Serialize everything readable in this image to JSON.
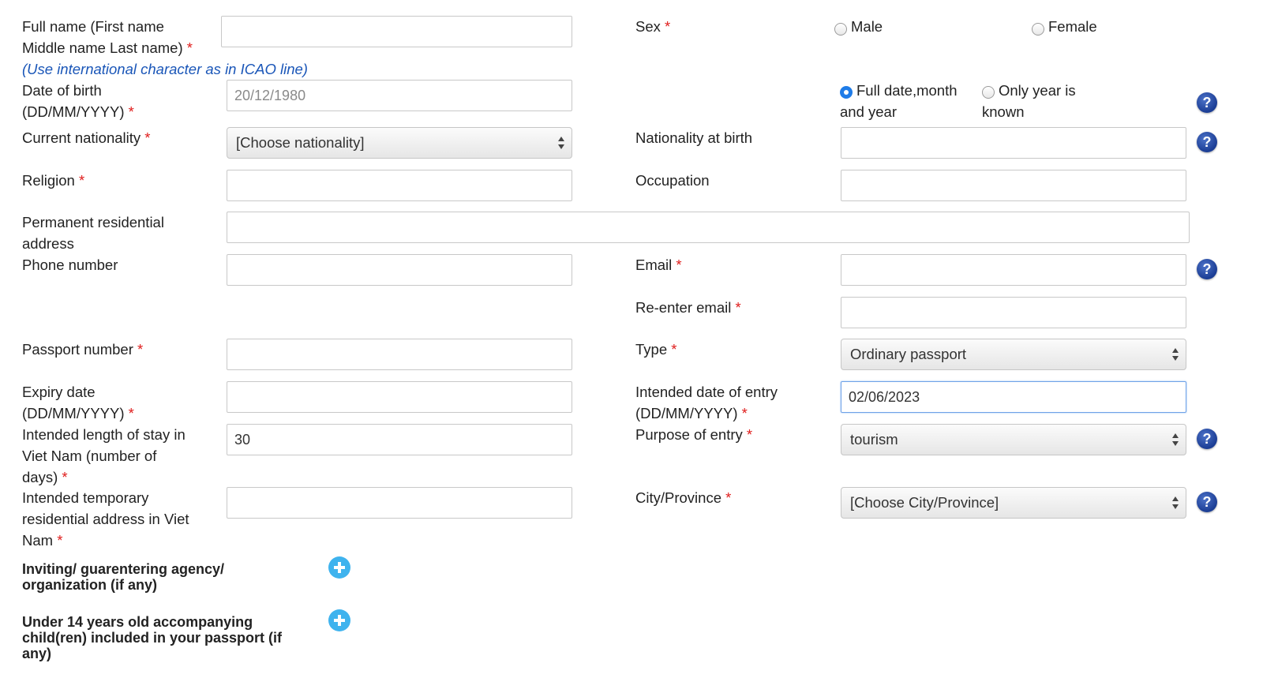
{
  "fields": {
    "full_name": {
      "label_line1": "Full name (First name",
      "label_line2": "Middle name Last name)",
      "required": "*",
      "value": "",
      "hint": "(Use international character as in ICAO line)"
    },
    "sex": {
      "label": "Sex",
      "required": "*",
      "options": [
        "Male",
        "Female"
      ],
      "selected": null
    },
    "dob": {
      "label_line1": "Date of birth",
      "label_line2": "(DD/MM/YYYY)",
      "required": "*",
      "placeholder": "20/12/1980",
      "value": ""
    },
    "dob_mode": {
      "options": [
        {
          "line1": "Full date,month",
          "line2": "and year",
          "selected": true
        },
        {
          "line1": "Only year is",
          "line2": "known",
          "selected": false
        }
      ],
      "help": "?"
    },
    "current_nationality": {
      "label": "Current nationality",
      "required": "*",
      "value": "[Choose nationality]"
    },
    "nationality_at_birth": {
      "label": "Nationality at birth",
      "value": "",
      "help": "?"
    },
    "religion": {
      "label": "Religion",
      "required": "*",
      "value": ""
    },
    "occupation": {
      "label": "Occupation",
      "value": ""
    },
    "permanent_address": {
      "label_line1": "Permanent residential",
      "label_line2": "address",
      "value": ""
    },
    "phone": {
      "label": "Phone number",
      "value": ""
    },
    "email": {
      "label": "Email",
      "required": "*",
      "value": "",
      "help": "?"
    },
    "reenter_email": {
      "label": "Re-enter email",
      "required": "*",
      "value": ""
    },
    "passport_number": {
      "label": "Passport number",
      "required": "*",
      "value": ""
    },
    "passport_type": {
      "label": "Type",
      "required": "*",
      "value": "Ordinary passport"
    },
    "expiry_date": {
      "label_line1": "Expiry date",
      "label_line2": "(DD/MM/YYYY)",
      "required": "*",
      "value": ""
    },
    "entry_date": {
      "label_line1": "Intended date of entry",
      "label_line2": "(DD/MM/YYYY)",
      "required": "*",
      "value": "02/06/2023"
    },
    "length_of_stay": {
      "label_line1": "Intended length of stay in",
      "label_line2": "Viet Nam (number of",
      "label_line3": "days)",
      "required": "*",
      "value": "30"
    },
    "purpose": {
      "label": "Purpose of entry",
      "required": "*",
      "value": "tourism",
      "help": "?"
    },
    "temp_address": {
      "label_line1": "Intended temporary",
      "label_line2": "residential address in Viet",
      "label_line3": "Nam",
      "required": "*",
      "value": ""
    },
    "city": {
      "label": "City/Province",
      "required": "*",
      "value": "[Choose City/Province]",
      "help": "?"
    }
  },
  "sections": {
    "inviting_agency": {
      "line1": "Inviting/ guarentering agency/",
      "line2": "organization (if any)"
    },
    "children": {
      "line1": "Under 14 years old accompanying",
      "line2": "child(ren) included in your passport (if",
      "line3": "any)"
    }
  },
  "colors": {
    "required": "#e0201f",
    "hint": "#1a56b8",
    "radio_selected": "#1f7ce8",
    "help_icon": "#1b3d94",
    "add_icon": "#3fb3ee",
    "focus_border": "#6ea2e8"
  }
}
